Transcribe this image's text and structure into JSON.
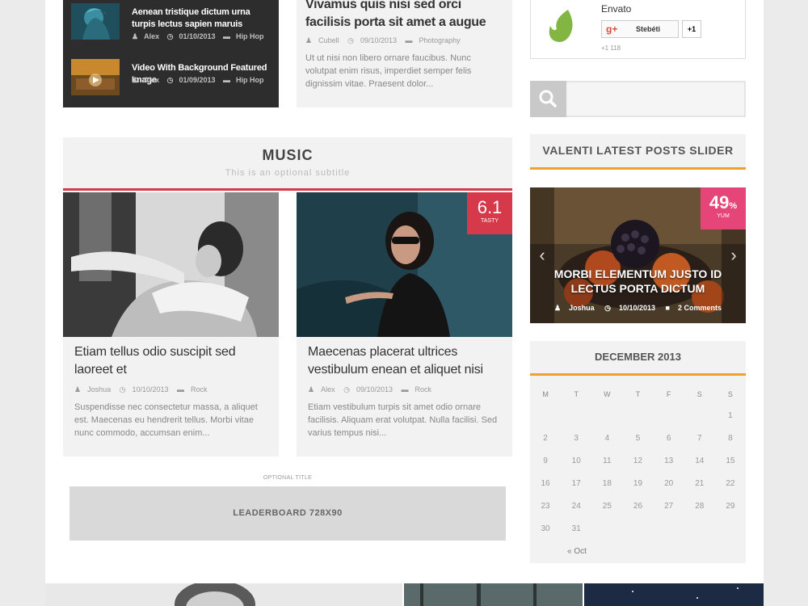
{
  "dark_widget": {
    "posts": [
      {
        "title": "Aenean tristique dictum urna turpis lectus sapien maruis",
        "author": "Alex",
        "date": "01/10/2013",
        "category": "Hip Hop"
      },
      {
        "title": "Video With Background Featured Image",
        "author": "Alex",
        "date": "01/09/2013",
        "category": "Hip Hop"
      }
    ]
  },
  "top_post": {
    "title": "Vivamus quis nisi sed orci facilisis porta sit amet a augue",
    "author": "Cubell",
    "date": "09/10/2013",
    "category": "Photography",
    "excerpt": "Ut ut nisi non libero ornare faucibus. Nunc volutpat enim risus, imperdiet semper felis dignissim vitae. Praesent dolor..."
  },
  "social": {
    "name": "Envato",
    "gplus_label": "Stebéti",
    "plus_one": "+1",
    "count": "+1 118",
    "colors": {
      "envato": "#82b541",
      "gplus": "#dd4b39"
    }
  },
  "search": {
    "placeholder": "",
    "icon": "search-icon"
  },
  "slider_widget": {
    "title": "VALENTI LATEST POSTS SLIDER",
    "badge_value": "49",
    "badge_unit": "%",
    "badge_label": "YUM",
    "post_title": "MORBI ELEMENTUM JUSTO ID LECTUS PORTA DICTUM",
    "author": "Joshua",
    "date": "10/10/2013",
    "comments": "2 Comments"
  },
  "calendar": {
    "title": "DECEMBER 2013",
    "weekdays": [
      "M",
      "T",
      "W",
      "T",
      "F",
      "S",
      "S"
    ],
    "weeks": [
      [
        "",
        "",
        "",
        "",
        "",
        "",
        "1"
      ],
      [
        "2",
        "3",
        "4",
        "5",
        "6",
        "7",
        "8"
      ],
      [
        "9",
        "10",
        "11",
        "12",
        "13",
        "14",
        "15"
      ],
      [
        "16",
        "17",
        "18",
        "19",
        "20",
        "21",
        "22"
      ],
      [
        "23",
        "24",
        "25",
        "26",
        "27",
        "28",
        "29"
      ],
      [
        "30",
        "31",
        "",
        "",
        "",
        "",
        ""
      ]
    ],
    "prev": "« Oct"
  },
  "music_section": {
    "title": "MUSIC",
    "subtitle": "This is an optional subtitle",
    "cards": [
      {
        "title": "Etiam tellus odio suscipit sed laoreet et",
        "author": "Joshua",
        "date": "10/10/2013",
        "category": "Rock",
        "excerpt": "Suspendisse nec consectetur massa, a aliquet est. Maecenas eu hendrerit tellus. Morbi vitae nunc commodo, accumsan enim..."
      },
      {
        "title": "Maecenas placerat ultrices vestibulum enean et aliquet nisi",
        "author": "Alex",
        "date": "09/10/2013",
        "category": "Rock",
        "excerpt": "Etiam vestibulum turpis sit amet odio ornare facilisis. Aliquam erat volutpat. Nulla facilisi. Sed varius tempus nisi...",
        "score": "6.1",
        "score_label": "TASTY"
      }
    ]
  },
  "ad": {
    "label": "OPTIONAL TITLE",
    "text": "LEADERBOARD 728X90"
  }
}
